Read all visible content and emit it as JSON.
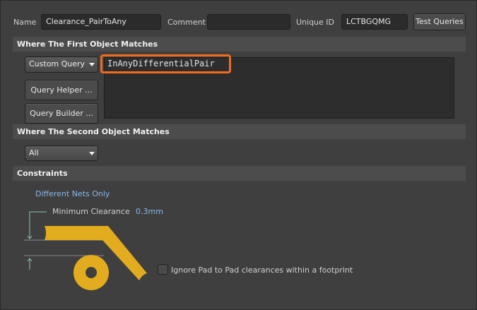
{
  "header": {
    "name_label": "Name",
    "name_value": "Clearance_PairToAny",
    "comment_label": "Comment",
    "comment_value": "",
    "uid_label": "Unique ID",
    "uid_value": "LCTBGQMG",
    "test_queries": "Test Queries"
  },
  "first": {
    "title": "Where The First Object Matches",
    "dropdown": "Custom Query",
    "query_helper": "Query Helper ...",
    "query_builder": "Query Builder ...",
    "query_text": "InAnyDifferentialPair"
  },
  "second": {
    "title": "Where The Second Object Matches",
    "dropdown": "All"
  },
  "constraints": {
    "title": "Constraints",
    "nets": "Different Nets Only",
    "min_clearance_label": "Minimum Clearance",
    "min_clearance_value": "0.3mm",
    "ignore_pad_label": "Ignore Pad to Pad clearances within a footprint",
    "ignore_pad_checked": false
  },
  "colors": {
    "highlight": "#f26b1d",
    "copper": "#e2ac1e",
    "link": "#8ab8ea"
  }
}
